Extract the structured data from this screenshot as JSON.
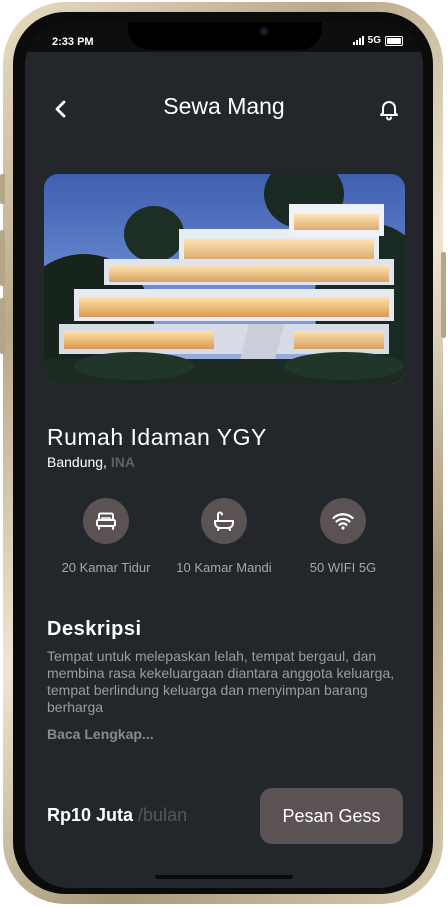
{
  "status_bar": {
    "time": "2:33 PM",
    "network": "5G"
  },
  "header": {
    "title": "Sewa Mang",
    "back_icon": "chevron-left-icon",
    "notification_icon": "bell-icon"
  },
  "property": {
    "name": "Rumah Idaman YGY",
    "city": "Bandung,",
    "country": "INA"
  },
  "features": [
    {
      "icon": "bed-icon",
      "label": "20 Kamar Tidur"
    },
    {
      "icon": "bathtub-icon",
      "label": "10 Kamar Mandi"
    },
    {
      "icon": "wifi-icon",
      "label": "50 WIFI 5G"
    }
  ],
  "description": {
    "title": "Deskripsi",
    "text": "Tempat untuk melepaskan lelah, tempat bergaul, dan membina rasa kekeluargaan diantara anggota keluarga, tempat berlindung keluarga dan menyimpan barang berharga",
    "read_more": "Baca Lengkap..."
  },
  "pricing": {
    "price": "Rp10 Juta",
    "unit": "/bulan"
  },
  "order_button": "Pesan Gess",
  "colors": {
    "background": "#23272b",
    "accent": "#5a5253",
    "text": "#ffffff",
    "muted": "#9c9c9c"
  }
}
